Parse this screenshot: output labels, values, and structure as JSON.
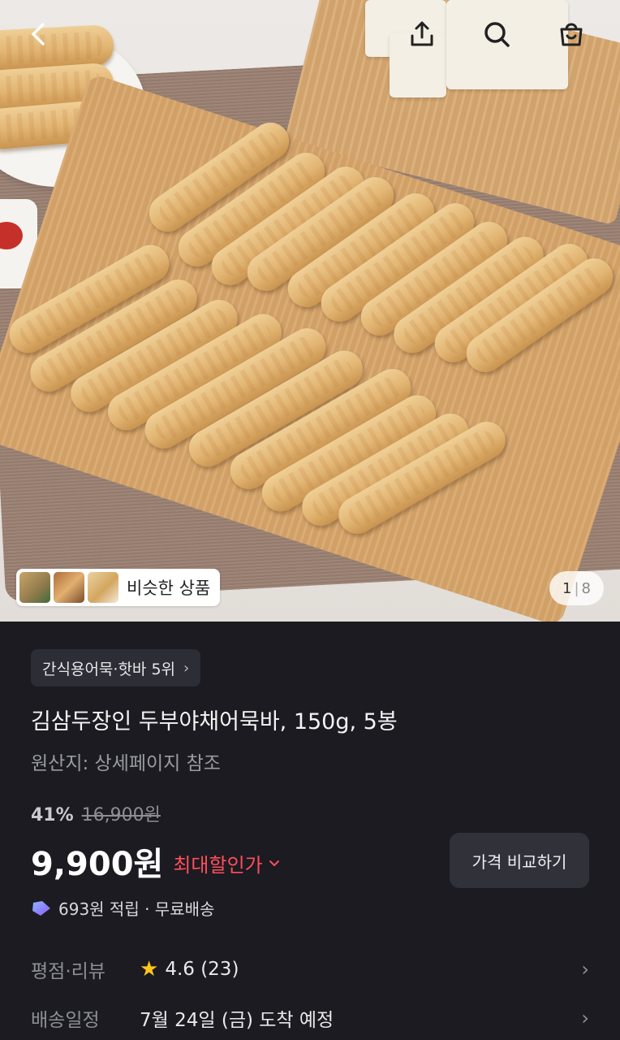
{
  "hero": {
    "similar_label": "비슷한 상품",
    "pager_current": "1",
    "pager_total": "8"
  },
  "product": {
    "rank_badge": "간식용어묵·핫바 5위",
    "title": "김삼두장인 두부야채어묵바, 150g, 5봉",
    "origin": "원산지: 상세페이지 참조",
    "discount_rate": "41%",
    "original_price": "16,900원",
    "price": "9,900원",
    "max_discount_label": "최대할인가",
    "compare_button": "가격 비교하기",
    "points_text": "693원 적립 · 무료배송"
  },
  "info_rows": {
    "rating_label": "평점·리뷰",
    "rating_value": "4.6 (23)",
    "delivery_label": "배송일정",
    "delivery_value": "7월 24일 (금) 도착 예정"
  },
  "colors": {
    "background": "#1b1b21",
    "accent_red": "#ff4d5b",
    "star": "#ffc61a"
  },
  "icons": [
    "back-arrow-icon",
    "share-icon",
    "search-icon",
    "cart-icon",
    "chevron-right-icon",
    "star-icon",
    "points-icon",
    "chevron-down-icon"
  ]
}
